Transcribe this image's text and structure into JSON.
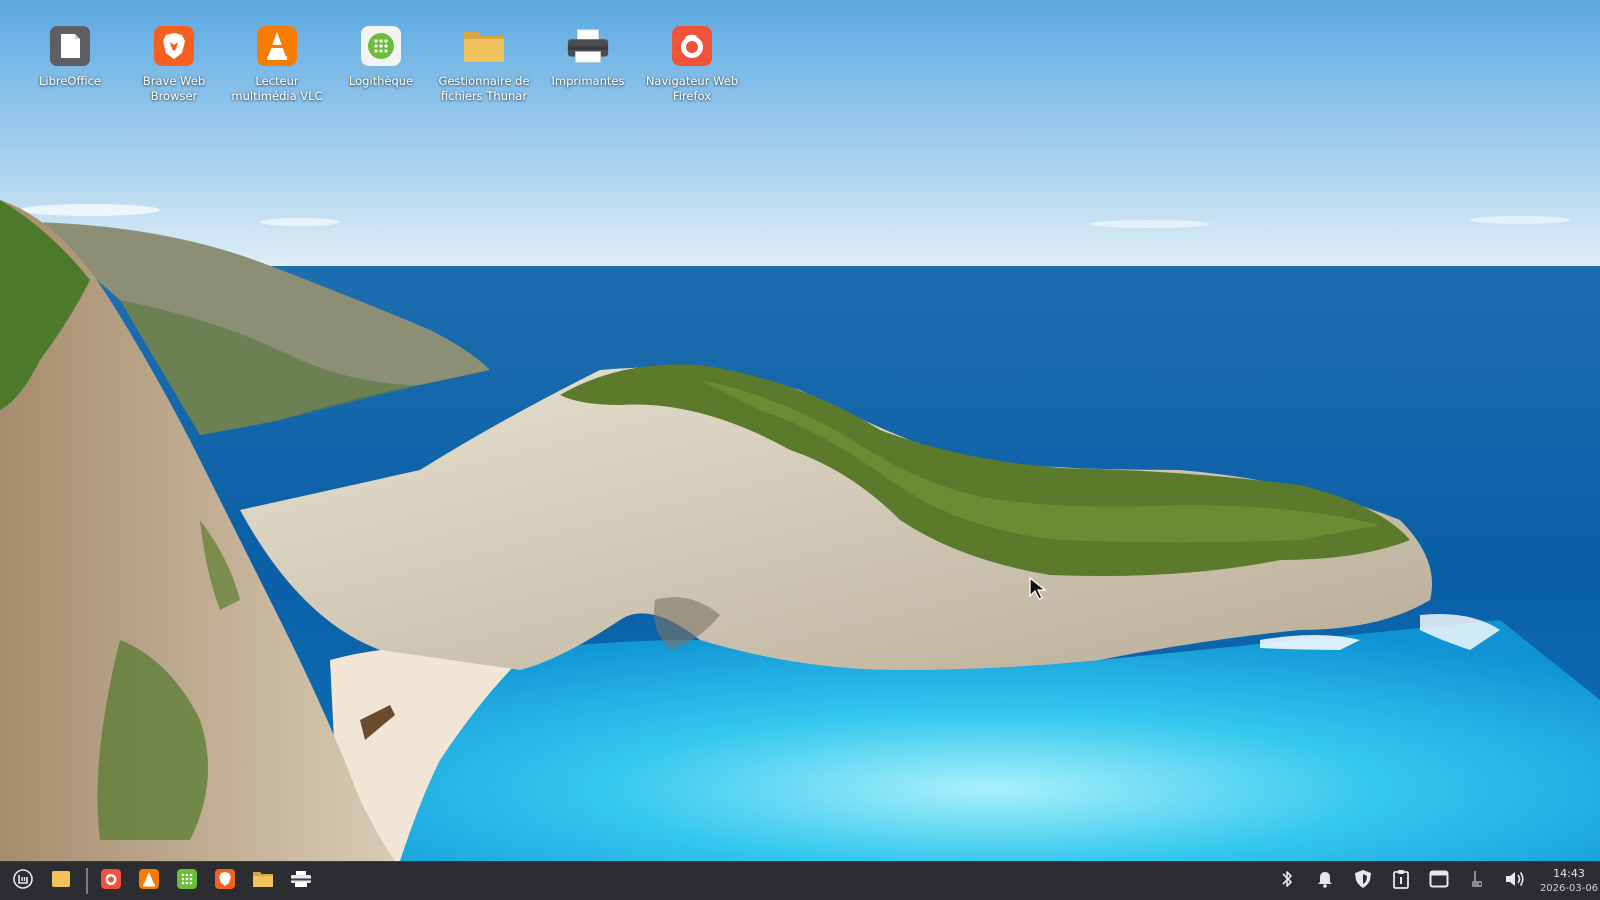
{
  "desktop": {
    "icons": [
      {
        "label": "LibreOffice",
        "icon": "libreoffice-icon"
      },
      {
        "label": "Brave Web Browser",
        "icon": "brave-icon"
      },
      {
        "label": "Lecteur multimédia VLC",
        "icon": "vlc-icon"
      },
      {
        "label": "Logithèque",
        "icon": "software-manager-icon"
      },
      {
        "label": "Gestionnaire de fichiers Thunar",
        "icon": "folder-icon"
      },
      {
        "label": "Imprimantes",
        "icon": "printer-icon"
      },
      {
        "label": "Navigateur Web Firefox",
        "icon": "firefox-icon"
      }
    ]
  },
  "panel": {
    "launchers": [
      {
        "icon": "menu-icon"
      },
      {
        "icon": "show-desktop-icon"
      },
      {
        "icon": "firefox-icon"
      },
      {
        "icon": "vlc-icon"
      },
      {
        "icon": "software-manager-icon"
      },
      {
        "icon": "brave-icon"
      },
      {
        "icon": "file-manager-icon"
      },
      {
        "icon": "printer-icon"
      }
    ],
    "tray": [
      {
        "icon": "bluetooth-icon"
      },
      {
        "icon": "notifications-bell-icon"
      },
      {
        "icon": "shield-icon"
      },
      {
        "icon": "clipboard-icon"
      },
      {
        "icon": "window-icon"
      },
      {
        "icon": "network-wired-icon"
      },
      {
        "icon": "volume-icon"
      }
    ],
    "clock": {
      "time": "14:43",
      "date": "2026-03-06"
    }
  },
  "colors": {
    "panel_bg": "#2b2d30",
    "desktop_label": "#ffffff",
    "firefox": "#f0523a",
    "brave": "#f5601e",
    "vlc": "#f57c00",
    "software": "#6cbd3a",
    "folder": "#f2c25c"
  }
}
